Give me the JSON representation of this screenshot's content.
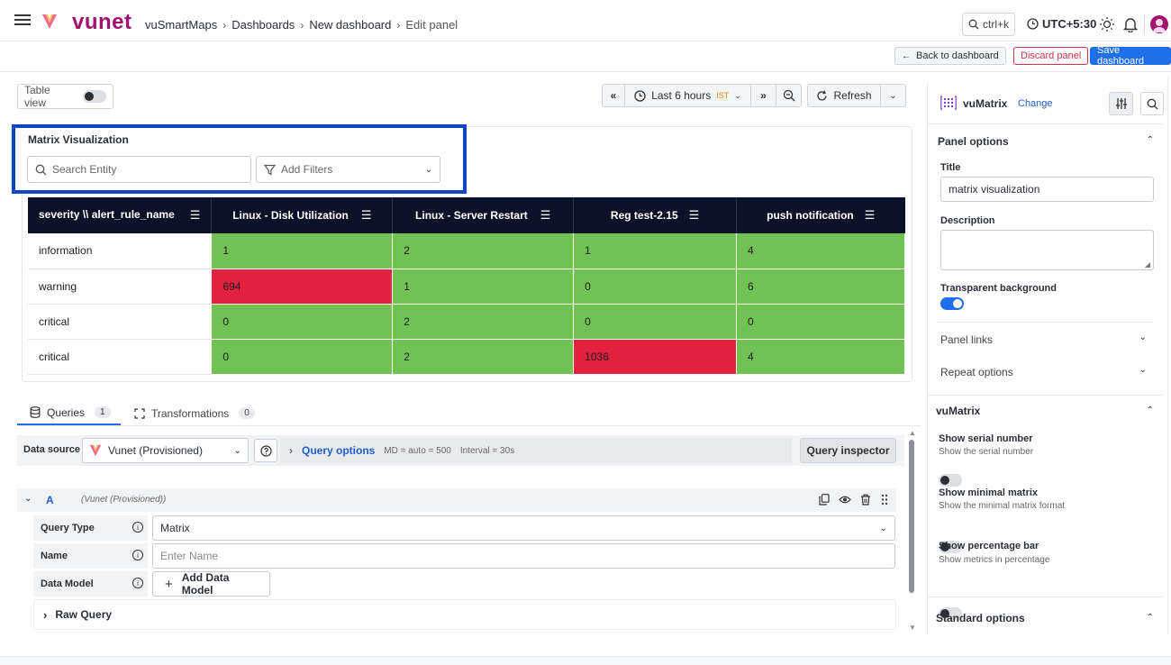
{
  "header": {
    "brand": "vunet",
    "breadcrumb": [
      "vuSmartMaps",
      "Dashboards",
      "New dashboard",
      "Edit panel"
    ],
    "search_shortcut": "ctrl+k",
    "timezone": "UTC+5:30"
  },
  "actions": {
    "back": "Back to dashboard",
    "discard": "Discard panel",
    "save": "Save dashboard"
  },
  "toolbar": {
    "table_view": "Table view",
    "time_range": "Last 6 hours",
    "tz_badge": "IST",
    "refresh": "Refresh"
  },
  "panel": {
    "title": "Matrix Visualization",
    "search_placeholder": "Search Entity",
    "filter_placeholder": "Add Filters"
  },
  "matrix": {
    "columns": [
      "severity \\\\ alert_rule_name",
      "Linux - Disk Utilization",
      "Linux - Server Restart",
      "Reg test-2.15",
      "push notification"
    ],
    "rows": [
      {
        "label": "information",
        "cells": [
          {
            "v": "1",
            "c": "g"
          },
          {
            "v": "2",
            "c": "g"
          },
          {
            "v": "1",
            "c": "g"
          },
          {
            "v": "4",
            "c": "g"
          }
        ]
      },
      {
        "label": "warning",
        "cells": [
          {
            "v": "694",
            "c": "r"
          },
          {
            "v": "1",
            "c": "g"
          },
          {
            "v": "0",
            "c": "g"
          },
          {
            "v": "6",
            "c": "g"
          }
        ]
      },
      {
        "label": "critical",
        "cells": [
          {
            "v": "0",
            "c": "g"
          },
          {
            "v": "2",
            "c": "g"
          },
          {
            "v": "0",
            "c": "g"
          },
          {
            "v": "0",
            "c": "g"
          }
        ]
      },
      {
        "label": "critical",
        "cells": [
          {
            "v": "0",
            "c": "g"
          },
          {
            "v": "2",
            "c": "g"
          },
          {
            "v": "1036",
            "c": "r"
          },
          {
            "v": "4",
            "c": "g"
          }
        ]
      }
    ]
  },
  "tabs": {
    "queries": "Queries",
    "queries_count": "1",
    "transformations": "Transformations",
    "transformations_count": "0"
  },
  "query_bar": {
    "datasource_label": "Data source",
    "datasource": "Vunet (Provisioned)",
    "query_options": "Query options",
    "md": "MD = auto = 500",
    "interval": "Interval = 30s",
    "inspector": "Query inspector"
  },
  "query": {
    "ref": "A",
    "source": "(Vunet (Provisioned))",
    "type_label": "Query Type",
    "type_value": "Matrix",
    "name_label": "Name",
    "name_placeholder": "Enter Name",
    "model_label": "Data Model",
    "add_model": "Add Data Model",
    "raw_query": "Raw Query"
  },
  "sidebar": {
    "viz_name": "vuMatrix",
    "change": "Change",
    "panel_options": "Panel options",
    "title_label": "Title",
    "title_value": "matrix visualization",
    "description_label": "Description",
    "transparent_label": "Transparent background",
    "panel_links": "Panel links",
    "repeat_options": "Repeat options",
    "vumatrix": "vuMatrix",
    "opt1_title": "Show serial number",
    "opt1_desc": "Show the serial number",
    "opt2_title": "Show minimal matrix",
    "opt2_desc": "Show the minimal matrix format",
    "opt3_title": "Show percentage bar",
    "opt3_desc": "Show metrics in percentage",
    "standard_options": "Standard options"
  }
}
